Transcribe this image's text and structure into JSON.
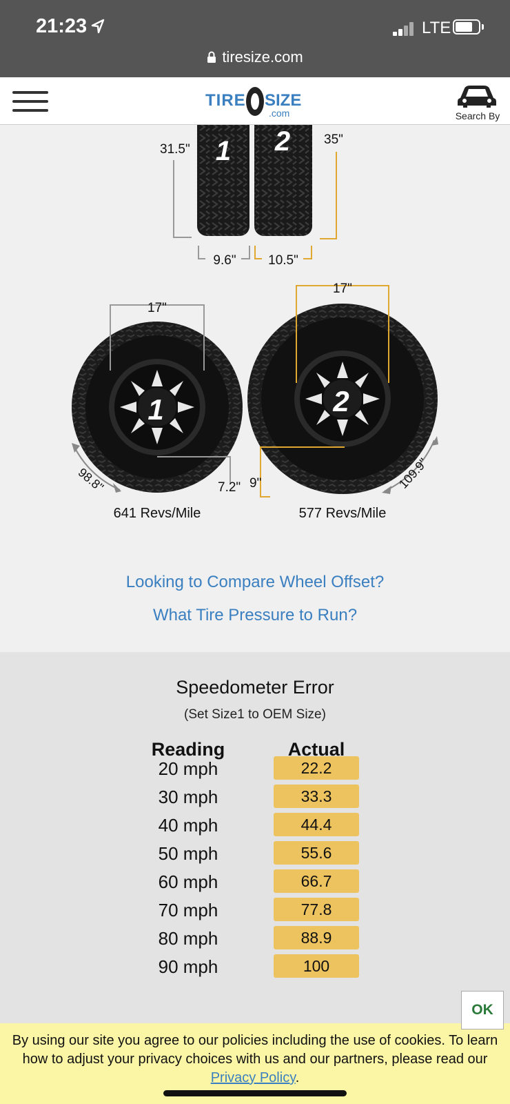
{
  "status": {
    "time": "21:23",
    "network": "LTE"
  },
  "browser": {
    "url": "tiresize.com"
  },
  "header": {
    "logo_tire": "TIRE",
    "logo_size": "SIZE",
    "logo_com": ".com",
    "search_by_label": "Search By"
  },
  "comparison": {
    "tire1": {
      "number": "1",
      "height": "31.5\"",
      "width": "9.6\"",
      "wheel_diameter": "17\"",
      "sidewall": "7.2\"",
      "circumference": "98.8\"",
      "revs": "641 Revs/Mile"
    },
    "tire2": {
      "number": "2",
      "height": "35\"",
      "width": "10.5\"",
      "wheel_diameter": "17\"",
      "sidewall": "9\"",
      "circumference": "109.9\"",
      "revs": "577 Revs/Mile"
    }
  },
  "links": {
    "offset": "Looking to Compare Wheel Offset?",
    "pressure": "What Tire Pressure to Run?"
  },
  "speedometer": {
    "title": "Speedometer Error",
    "subtitle": "(Set Size1 to OEM Size)",
    "col_reading": "Reading",
    "col_actual": "Actual",
    "rows": [
      {
        "reading": "20 mph",
        "actual": "22.2"
      },
      {
        "reading": "30 mph",
        "actual": "33.3"
      },
      {
        "reading": "40 mph",
        "actual": "44.4"
      },
      {
        "reading": "50 mph",
        "actual": "55.6"
      },
      {
        "reading": "60 mph",
        "actual": "66.7"
      },
      {
        "reading": "70 mph",
        "actual": "77.8"
      },
      {
        "reading": "80 mph",
        "actual": "88.9"
      },
      {
        "reading": "90 mph",
        "actual": "100"
      }
    ]
  },
  "cookie": {
    "text": "By using our site you agree to our policies including the use of cookies. To learn how to adjust your privacy choices with us and our partners, please read our ",
    "link": "Privacy Policy",
    "period": ".",
    "ok": "OK"
  },
  "colors": {
    "accent": "#3a7fc0",
    "highlight": "#ecc35f",
    "tire2_line": "#e0a830",
    "cookie_bg": "#fbf6a5"
  }
}
